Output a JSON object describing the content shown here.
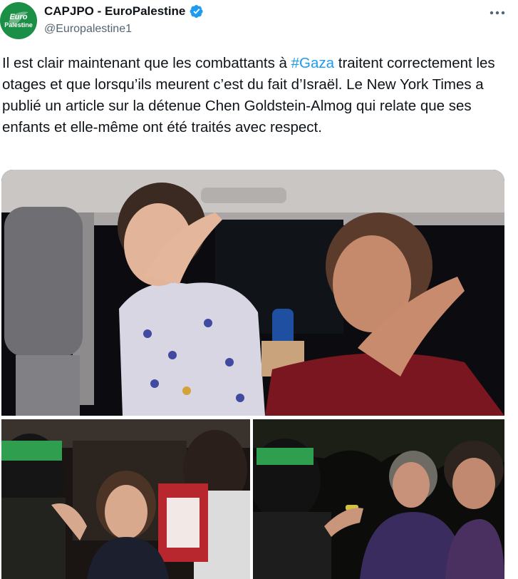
{
  "author": {
    "avatar_text_line1": "Euro",
    "avatar_text_line2": "Palestine",
    "display_name": "CAPJPO - EuroPalestine",
    "handle": "@Europalestine1",
    "verified_icon": "verified-badge-icon",
    "verified_color": "#1d9bf0"
  },
  "menu": {
    "more_label": "•••"
  },
  "tweet": {
    "text_before": "Il est clair maintenant que les combattants à ",
    "hashtag": "#Gaza",
    "text_after": " traitent correctement les otages et que lorsqu’ils meurent c’est du fait d’Israël. Le New York Times a publié un article sur la détenue Chen Goldstein-Almog qui relate que ses enfants et elle-même ont été traités avec respect."
  },
  "media": {
    "images": [
      {
        "kind": "photo",
        "subject": "girl waving in vehicle"
      },
      {
        "kind": "photo",
        "subject": "young woman at vehicle door"
      },
      {
        "kind": "photo",
        "subject": "two elderly women at night"
      }
    ]
  },
  "colors": {
    "text": "#0f1419",
    "secondary": "#536471",
    "link": "#1d9bf0",
    "avatar_bg": "#1b8f45"
  }
}
